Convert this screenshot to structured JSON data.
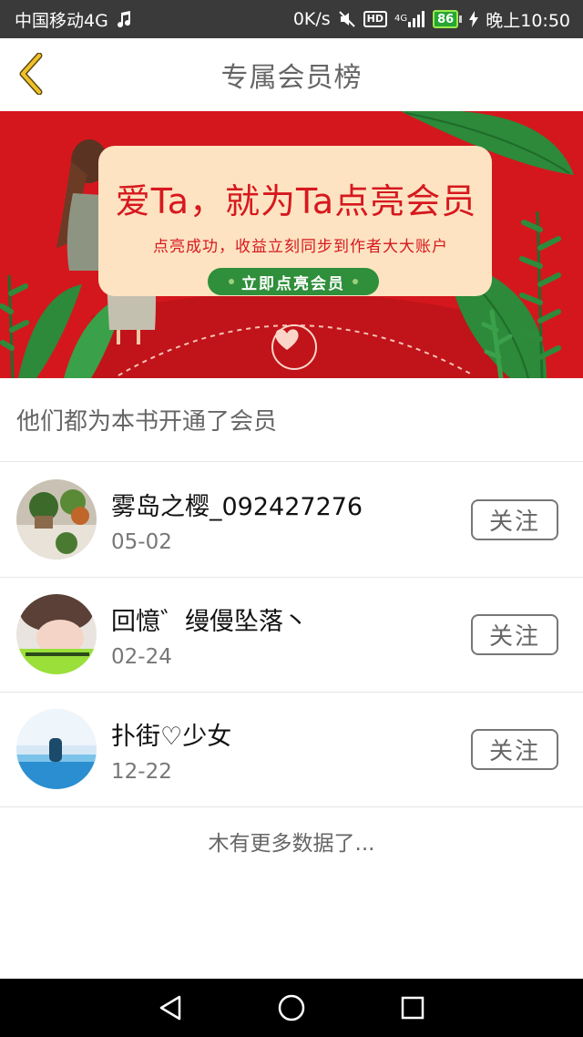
{
  "status_bar": {
    "carrier": "中国移动4G",
    "music_icon": "music-note-icon",
    "speed": "0K/s",
    "hd": "HD",
    "network": "4G",
    "battery": "86",
    "time": "晚上10:50"
  },
  "header": {
    "title": "专属会员榜",
    "back_icon": "chevron-left-icon"
  },
  "banner": {
    "headline": "爱Ta，就为Ta点亮会员",
    "subtitle": "点亮成功，收益立刻同步到作者大大账户",
    "cta": "立即点亮会员"
  },
  "section": {
    "title": "他们都为本书开通了会员"
  },
  "members": [
    {
      "name": "雾岛之樱_092427276",
      "date": "05-02",
      "follow": "关注"
    },
    {
      "name": "回憶゛缦僈坠落丶",
      "date": "02-24",
      "follow": "关注"
    },
    {
      "name": "扑街♡少女",
      "date": "12-22",
      "follow": "关注"
    }
  ],
  "footer": {
    "no_more": "木有更多数据了..."
  },
  "colors": {
    "banner_red": "#d4171d",
    "banner_card": "#fde3c1",
    "cta_green": "#2f8f3b",
    "back_arrow": "#f1c02a",
    "status_bar_bg": "#3a3a3a"
  }
}
